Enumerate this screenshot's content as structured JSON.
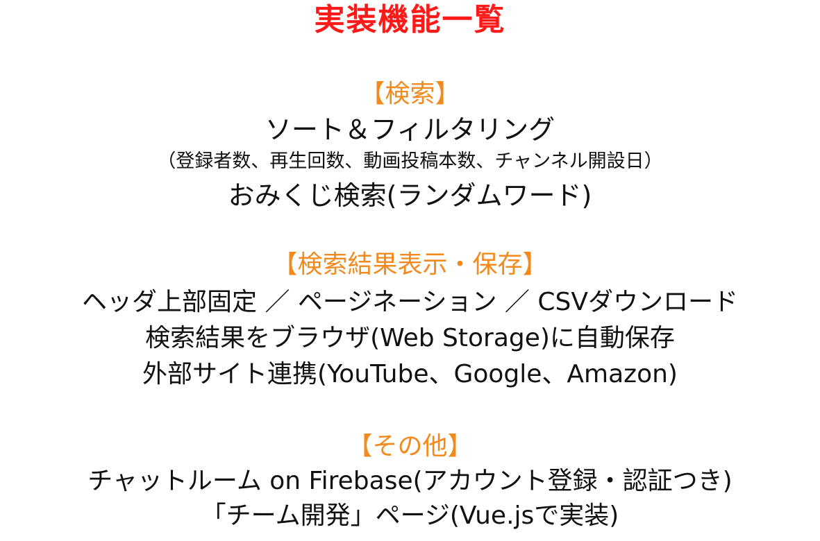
{
  "title": "実装機能一覧",
  "sections": [
    {
      "heading": "【検索】",
      "lines": [
        "ソート＆フィルタリング",
        "（登録者数、再生回数、動画投稿本数、チャンネル開設日）",
        "おみくじ検索(ランダムワード)"
      ]
    },
    {
      "heading": "【検索結果表示・保存】",
      "lines": [
        "ヘッダ上部固定 ／ ページネーション ／ CSVダウンロード",
        "検索結果をブラウザ(Web Storage)に自動保存",
        "外部サイト連携(YouTube、Google、Amazon)"
      ]
    },
    {
      "heading": "【その他】",
      "lines": [
        "チャットルーム on Firebase(アカウント登録・認証つき)",
        "「チーム開発」ページ(Vue.jsで実装)"
      ]
    }
  ],
  "colors": {
    "title": "#ff1a1a",
    "heading": "#f28a1e",
    "text": "#111111"
  }
}
